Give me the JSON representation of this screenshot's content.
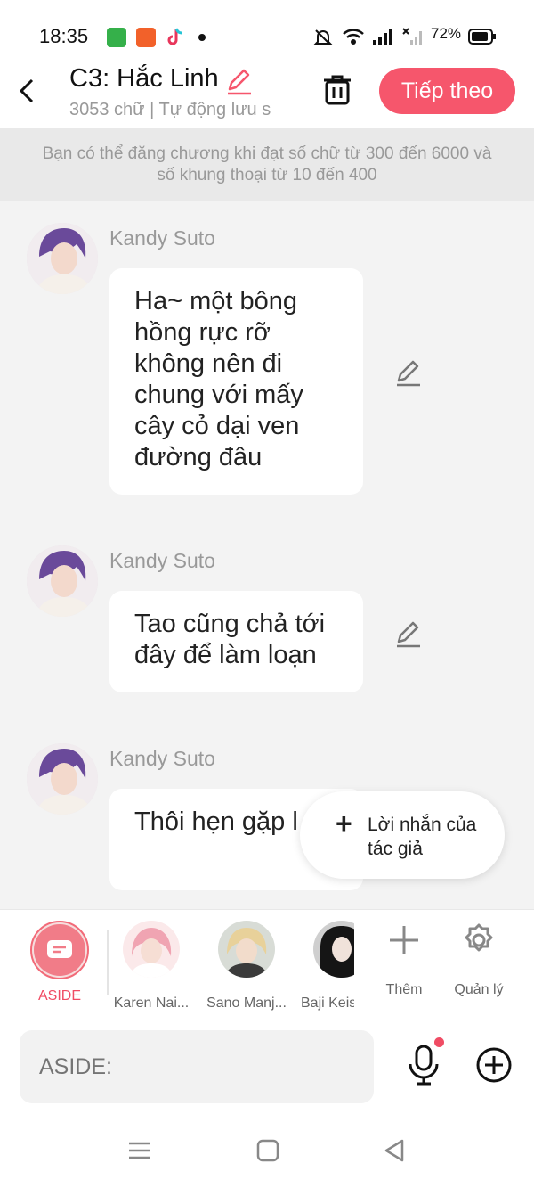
{
  "status_bar": {
    "time": "18:35",
    "battery": "72%",
    "icons": [
      "app-green-icon",
      "app-orange-icon",
      "tiktok-icon",
      "notification-dot",
      "mute-bell-icon",
      "wifi-icon",
      "signal-icon",
      "signal-x-icon",
      "battery-icon"
    ]
  },
  "header": {
    "title": "C3: Hắc Linh",
    "subtitle": "3053 chữ | Tự động lưu s",
    "next_label": "Tiếp theo",
    "accent_color": "#f6566c"
  },
  "banner": {
    "text": "Bạn có thể đăng chương khi đạt số chữ từ 300 đến 6000 và số khung thoại từ 10 đến 400"
  },
  "messages": [
    {
      "author": "Kandy Suto",
      "text": "Ha~ một bông hồng rực rỡ không nên đi chung với mấy cây cỏ dại ven đường đâu"
    },
    {
      "author": "Kandy Suto",
      "text": "Tao cũng chả tới đây để làm loạn"
    },
    {
      "author": "Kandy Suto",
      "text": "Thôi hẹn gặp l nhé lũ Touman"
    }
  ],
  "floating_note": {
    "label": "Lời nhắn của tác giả"
  },
  "characters": {
    "aside_label": "ASIDE",
    "items": [
      {
        "name": "Karen Nai..."
      },
      {
        "name": "Sano Manj..."
      },
      {
        "name": "Baji Keis"
      }
    ],
    "add_label": "Thêm",
    "manage_label": "Quản lý"
  },
  "input": {
    "placeholder": "ASIDE:"
  }
}
